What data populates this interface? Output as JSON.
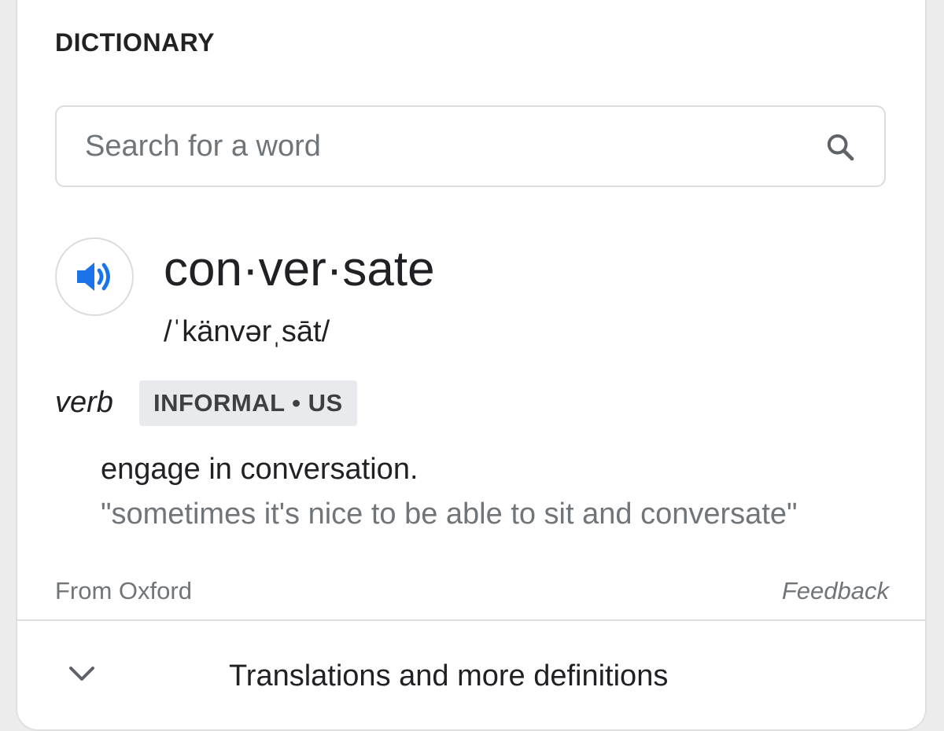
{
  "dictionary": {
    "heading": "DICTIONARY",
    "search": {
      "placeholder": "Search for a word",
      "value": ""
    },
    "entry": {
      "word": "con·ver·sate",
      "phonetic": "/ˈkänvərˌsāt/",
      "part_of_speech": "verb",
      "labels": "INFORMAL • US",
      "definition": "engage in conversation.",
      "example": "\"sometimes it's nice to be able to sit and conversate\""
    },
    "footer": {
      "source": "From Oxford",
      "feedback": "Feedback"
    },
    "expander": {
      "label": "Translations and more definitions"
    },
    "icons": {
      "audio": "speaker-icon",
      "search": "search-icon",
      "expand": "chevron-down-icon"
    },
    "colors": {
      "accent": "#1a73e8",
      "text": "#202124",
      "secondary": "#70757a",
      "border": "#dadce0",
      "badge_bg": "#e8eaed"
    }
  }
}
